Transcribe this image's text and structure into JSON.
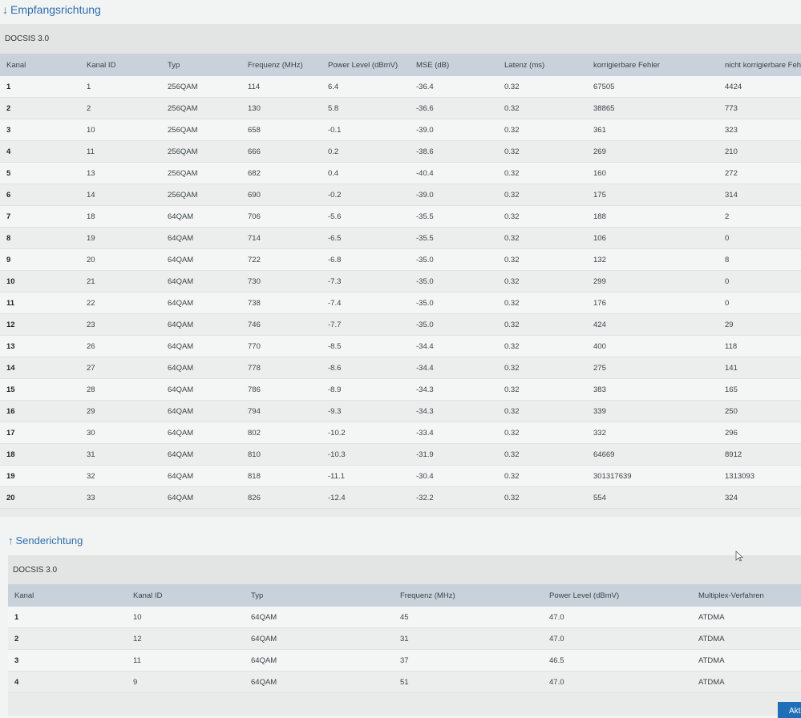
{
  "downstream": {
    "heading_arrow": "↓",
    "heading": "Empfangsrichtung",
    "panel_title": "DOCSIS 3.0",
    "columns": [
      "Kanal",
      "Kanal ID",
      "Typ",
      "Frequenz (MHz)",
      "Power Level (dBmV)",
      "MSE (dB)",
      "Latenz (ms)",
      "korrigierbare Fehler",
      "nicht korrigierbare Fehler"
    ],
    "rows": [
      [
        "1",
        "1",
        "256QAM",
        "114",
        "6.4",
        "-36.4",
        "0.32",
        "67505",
        "4424"
      ],
      [
        "2",
        "2",
        "256QAM",
        "130",
        "5.8",
        "-36.6",
        "0.32",
        "38865",
        "773"
      ],
      [
        "3",
        "10",
        "256QAM",
        "658",
        "-0.1",
        "-39.0",
        "0.32",
        "361",
        "323"
      ],
      [
        "4",
        "11",
        "256QAM",
        "666",
        "0.2",
        "-38.6",
        "0.32",
        "269",
        "210"
      ],
      [
        "5",
        "13",
        "256QAM",
        "682",
        "0.4",
        "-40.4",
        "0.32",
        "160",
        "272"
      ],
      [
        "6",
        "14",
        "256QAM",
        "690",
        "-0.2",
        "-39.0",
        "0.32",
        "175",
        "314"
      ],
      [
        "7",
        "18",
        "64QAM",
        "706",
        "-5.6",
        "-35.5",
        "0.32",
        "188",
        "2"
      ],
      [
        "8",
        "19",
        "64QAM",
        "714",
        "-6.5",
        "-35.5",
        "0.32",
        "106",
        "0"
      ],
      [
        "9",
        "20",
        "64QAM",
        "722",
        "-6.8",
        "-35.0",
        "0.32",
        "132",
        "8"
      ],
      [
        "10",
        "21",
        "64QAM",
        "730",
        "-7.3",
        "-35.0",
        "0.32",
        "299",
        "0"
      ],
      [
        "11",
        "22",
        "64QAM",
        "738",
        "-7.4",
        "-35.0",
        "0.32",
        "176",
        "0"
      ],
      [
        "12",
        "23",
        "64QAM",
        "746",
        "-7.7",
        "-35.0",
        "0.32",
        "424",
        "29"
      ],
      [
        "13",
        "26",
        "64QAM",
        "770",
        "-8.5",
        "-34.4",
        "0.32",
        "400",
        "118"
      ],
      [
        "14",
        "27",
        "64QAM",
        "778",
        "-8.6",
        "-34.4",
        "0.32",
        "275",
        "141"
      ],
      [
        "15",
        "28",
        "64QAM",
        "786",
        "-8.9",
        "-34.3",
        "0.32",
        "383",
        "165"
      ],
      [
        "16",
        "29",
        "64QAM",
        "794",
        "-9.3",
        "-34.3",
        "0.32",
        "339",
        "250"
      ],
      [
        "17",
        "30",
        "64QAM",
        "802",
        "-10.2",
        "-33.4",
        "0.32",
        "332",
        "296"
      ],
      [
        "18",
        "31",
        "64QAM",
        "810",
        "-10.3",
        "-31.9",
        "0.32",
        "64669",
        "8912"
      ],
      [
        "19",
        "32",
        "64QAM",
        "818",
        "-11.1",
        "-30.4",
        "0.32",
        "301317639",
        "1313093"
      ],
      [
        "20",
        "33",
        "64QAM",
        "826",
        "-12.4",
        "-32.2",
        "0.32",
        "554",
        "324"
      ]
    ]
  },
  "upstream": {
    "heading_arrow": "↑",
    "heading": "Senderichtung",
    "panel_title": "DOCSIS 3.0",
    "columns": [
      "Kanal",
      "Kanal ID",
      "Typ",
      "Frequenz (MHz)",
      "Power Level (dBmV)",
      "Multiplex-Verfahren"
    ],
    "rows": [
      [
        "1",
        "10",
        "64QAM",
        "45",
        "47.0",
        "ATDMA"
      ],
      [
        "2",
        "12",
        "64QAM",
        "31",
        "47.0",
        "ATDMA"
      ],
      [
        "3",
        "11",
        "64QAM",
        "37",
        "46.5",
        "ATDMA"
      ],
      [
        "4",
        "9",
        "64QAM",
        "51",
        "47.0",
        "ATDMA"
      ]
    ]
  },
  "refresh_button": "Aktu",
  "icons": {
    "cursor": "mouse-pointer-icon"
  },
  "colors": {
    "heading": "#2f6fad",
    "header_bg": "#c9d1da",
    "button": "#1f6fb8"
  }
}
